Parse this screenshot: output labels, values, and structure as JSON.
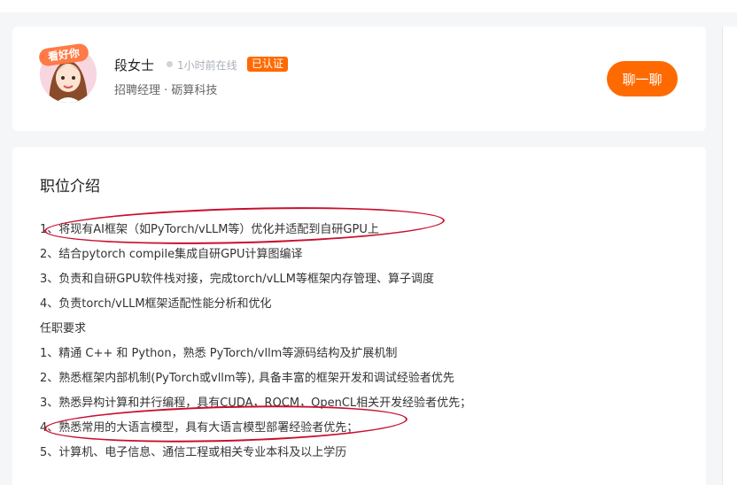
{
  "recruiter": {
    "name": "段女士",
    "online_status": "1小时前在线",
    "verified_badge": "已认证",
    "subtitle": "招聘经理 · 砺算科技",
    "avatar_badge": "看好你",
    "chat_button": "聊一聊"
  },
  "job": {
    "section_title": "职位介绍",
    "lines": [
      "1、将现有AI框架（如PyTorch/vLLM等）优化并适配到自研GPU上",
      "2、结合pytorch compile集成自研GPU计算图编译",
      "3、负责和自研GPU软件栈对接，完成torch/vLLM等框架内存管理、算子调度",
      "4、负责torch/vLLM框架适配性能分析和优化",
      "任职要求",
      "1、精通 C++ 和 Python，熟悉 PyTorch/vllm等源码结构及扩展机制",
      "2、熟悉框架内部机制(PyTorch或vllm等), 具备丰富的框架开发和调试经验者优先",
      "3、熟悉异构计算和并行编程，具有CUDA，ROCM，OpenCL相关开发经验者优先；",
      "4、熟悉常用的大语言模型，具有大语言模型部署经验者优先；",
      "5、计算机、电子信息、通信工程或相关专业本科及以上学历"
    ]
  },
  "colors": {
    "accent": "#ff6a00",
    "annotation": "#c8102e"
  }
}
